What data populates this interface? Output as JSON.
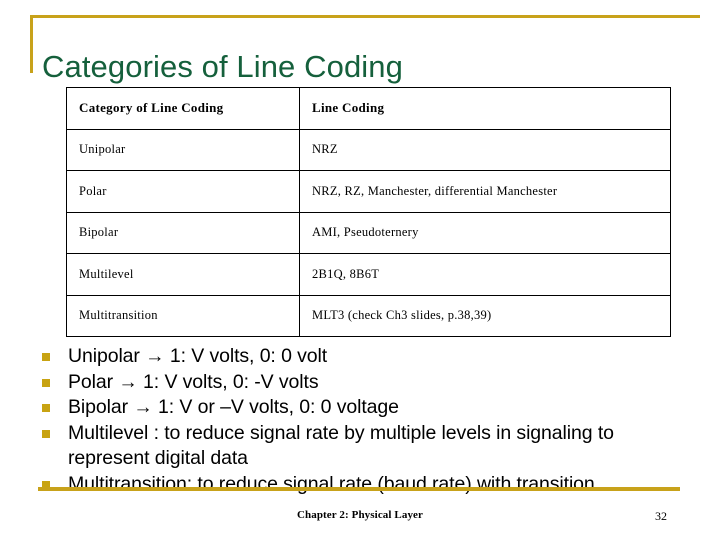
{
  "slide": {
    "title": "Categories of Line Coding",
    "accent_gold": "#C8A21A",
    "title_green": "#15603C",
    "bullet_marker_color": "#C8A312"
  },
  "table": {
    "headers": {
      "category": "Category of Line Coding",
      "coding": "Line Coding"
    },
    "rows": [
      {
        "category": "Unipolar",
        "coding": "NRZ"
      },
      {
        "category": "Polar",
        "coding": "NRZ, RZ, Manchester, differential Manchester"
      },
      {
        "category": "Bipolar",
        "coding": "AMI, Pseudoternery"
      },
      {
        "category": "Multilevel",
        "coding": "2B1Q, 8B6T"
      },
      {
        "category": "Multitransition",
        "coding": "MLT3  (check Ch3 slides, p.38,39)"
      }
    ]
  },
  "bullets": [
    {
      "text": "Unipolar → 1: V volts, 0: 0 volt"
    },
    {
      "text": "Polar → 1:  V volts, 0: -V volts"
    },
    {
      "text": "Bipolar → 1: V or –V volts, 0: 0 voltage"
    },
    {
      "text": "Multilevel : to reduce signal rate by multiple levels in signaling to represent digital data"
    },
    {
      "text": "Multitransition: to reduce signal rate (baud rate) with transition"
    }
  ],
  "footer": {
    "note": "Chapter 2: Physical Layer",
    "page_number": "32"
  }
}
